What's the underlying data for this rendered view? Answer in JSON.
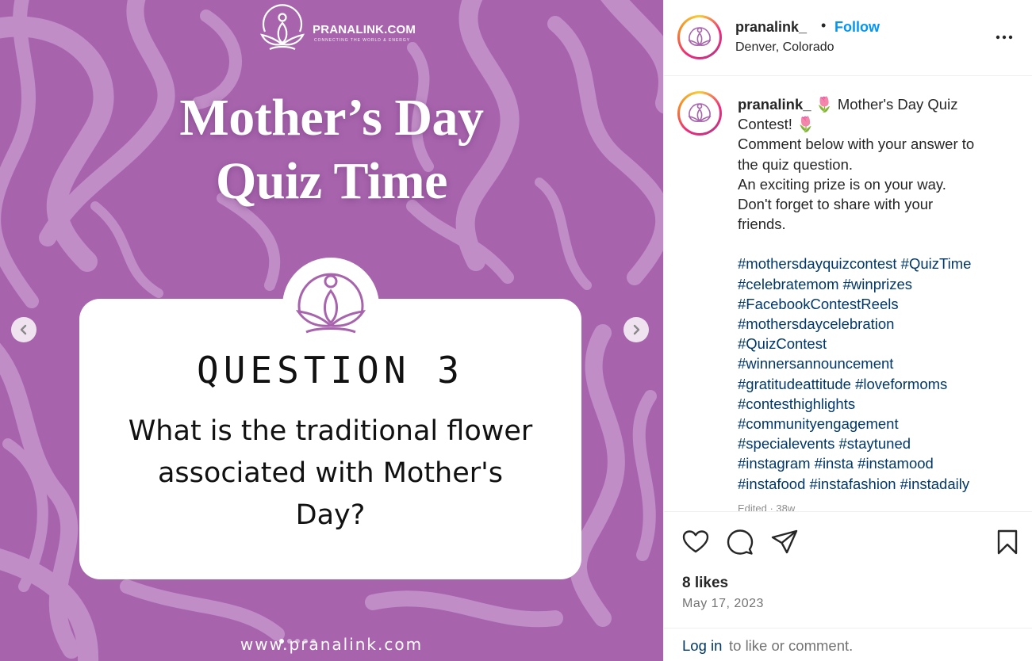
{
  "post_image": {
    "brand": {
      "name": "PRANALINK.COM",
      "tagline": "CONNECTING THE WORLD & ENERGY"
    },
    "headline_line1": "Mother’s Day",
    "headline_line2": "Quiz Time",
    "question_number": "QUESTION 3",
    "question_line1": "What is the traditional flower",
    "question_line2": "associated with Mother's",
    "question_line3": "Day?",
    "website": "www.pranalink.com",
    "background_color": "#a764ad",
    "carousel": {
      "total_slides": 5,
      "active_slide": 1
    },
    "prev_icon": "chevron-left-icon",
    "next_icon": "chevron-right-icon"
  },
  "header": {
    "username": "pranalink_",
    "separator": "•",
    "follow_label": "Follow",
    "location": "Denver, Colorado",
    "more_icon": "more-options-icon"
  },
  "caption": {
    "username": "pranalink_",
    "line1": "🌷 Mother's Day Quiz",
    "line2": "Contest! 🌷",
    "line3": "Comment below with your answer to",
    "line4": "the quiz question.",
    "line5": "An exciting prize is on your way.",
    "line6": "Don't forget to share with your",
    "line7": "friends.",
    "hashtags": [
      "#mothersdayquizcontest #QuizTime",
      "#celebratemom #winprizes",
      "#FacebookContestReels",
      "#mothersdaycelebration",
      "#QuizContest",
      "#winnersannouncement",
      "#gratitudeattitude #loveformoms",
      "#contesthighlights",
      "#communityengagement",
      "#specialevents #staytuned",
      "#instagram #insta #instamood",
      "#instafood #instafashion #instadaily"
    ],
    "edited": "Edited · 38w"
  },
  "actions": {
    "like_icon": "heart-icon",
    "comment_icon": "comment-icon",
    "share_icon": "share-icon",
    "save_icon": "bookmark-icon",
    "likes": "8 likes",
    "date": "May 17, 2023"
  },
  "footer": {
    "login_label": "Log in",
    "login_suffix": "to like or comment."
  },
  "colors": {
    "link_blue": "#0095f6",
    "hashtag_blue": "#00376b",
    "text": "#262626",
    "muted": "#737373"
  }
}
